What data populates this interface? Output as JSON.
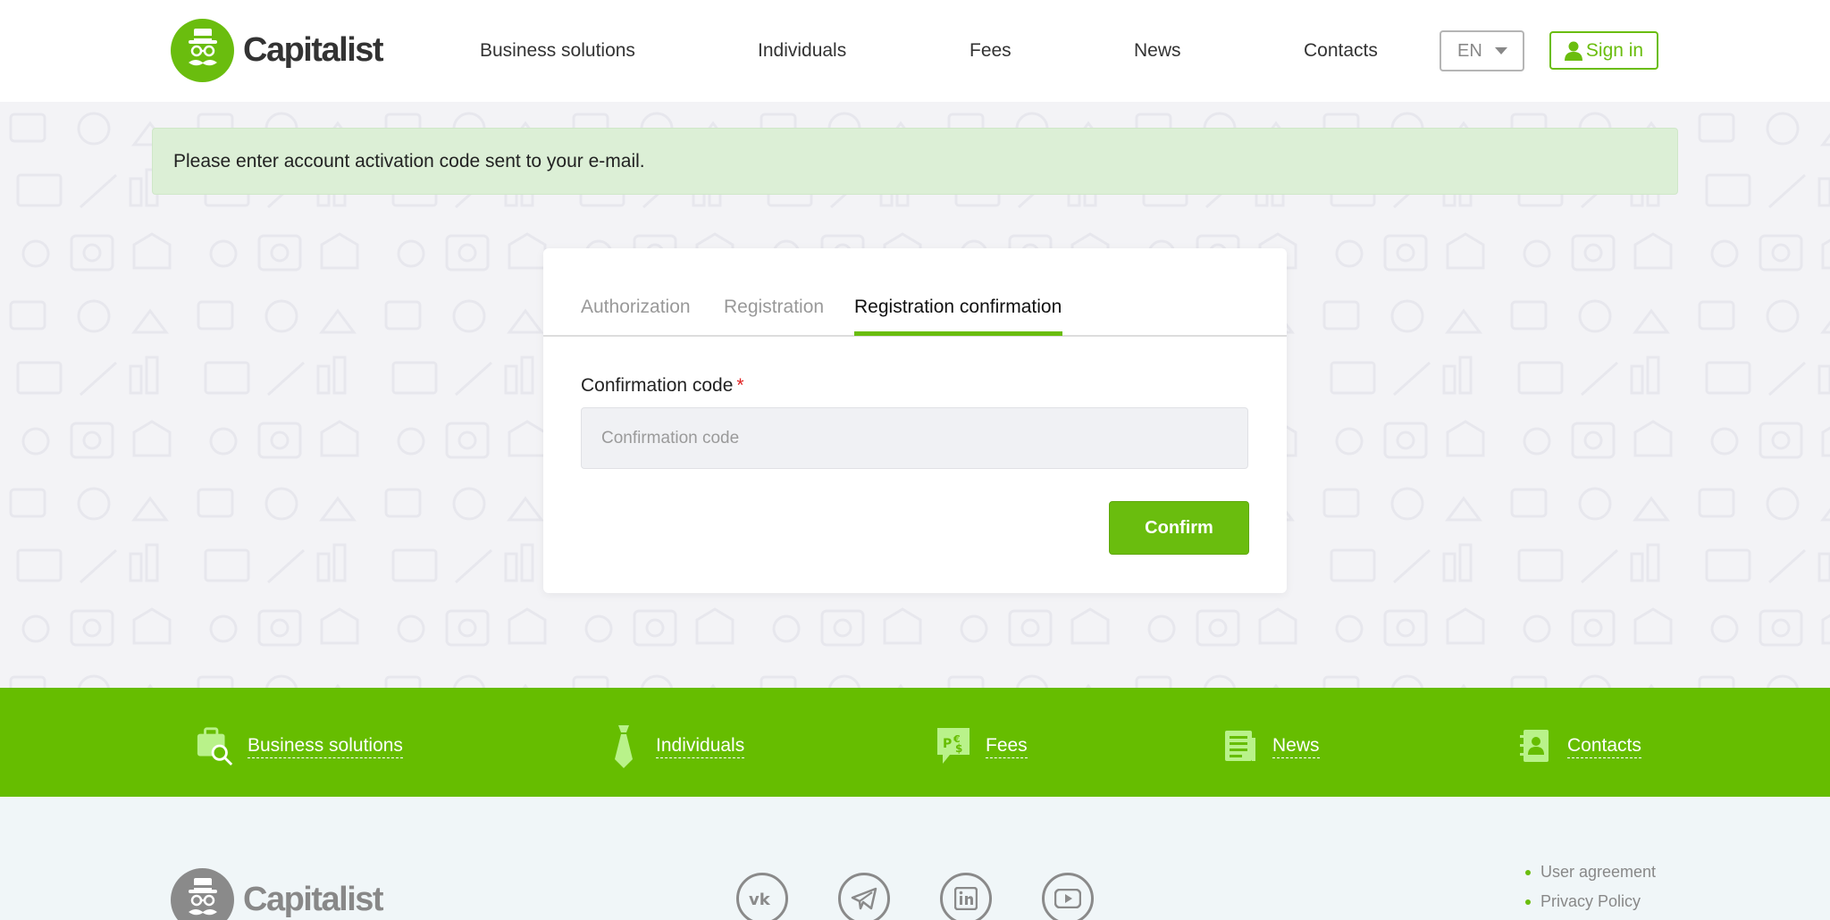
{
  "brand": {
    "name": "Capitalist",
    "accent": "#6abd0e",
    "band": "#66bd00"
  },
  "nav": {
    "items": [
      {
        "label": "Business solutions"
      },
      {
        "label": "Individuals"
      },
      {
        "label": "Fees"
      },
      {
        "label": "News"
      },
      {
        "label": "Contacts"
      }
    ],
    "language": "EN",
    "sign_in": "Sign in"
  },
  "alert": {
    "message": "Please enter account activation code sent to your e-mail."
  },
  "auth_card": {
    "tabs": [
      {
        "label": "Authorization"
      },
      {
        "label": "Registration"
      },
      {
        "label": "Registration confirmation"
      }
    ],
    "active_tab": "Registration confirmation",
    "field_label": "Confirmation code",
    "required_mark": "*",
    "input": {
      "placeholder": "Confirmation code",
      "value": ""
    },
    "confirm_label": "Confirm"
  },
  "band": {
    "items": [
      {
        "label": "Business solutions",
        "icon": "briefcase-search-icon"
      },
      {
        "label": "Individuals",
        "icon": "tie-icon"
      },
      {
        "label": "Fees",
        "icon": "currency-bubble-icon"
      },
      {
        "label": "News",
        "icon": "newspaper-icon"
      },
      {
        "label": "Contacts",
        "icon": "address-book-icon"
      }
    ]
  },
  "footer": {
    "logo": "Capitalist",
    "social": [
      "vk-icon",
      "telegram-icon",
      "linkedin-icon",
      "youtube-icon"
    ],
    "links": [
      {
        "label": "User agreement"
      },
      {
        "label": "Privacy Policy"
      }
    ]
  }
}
